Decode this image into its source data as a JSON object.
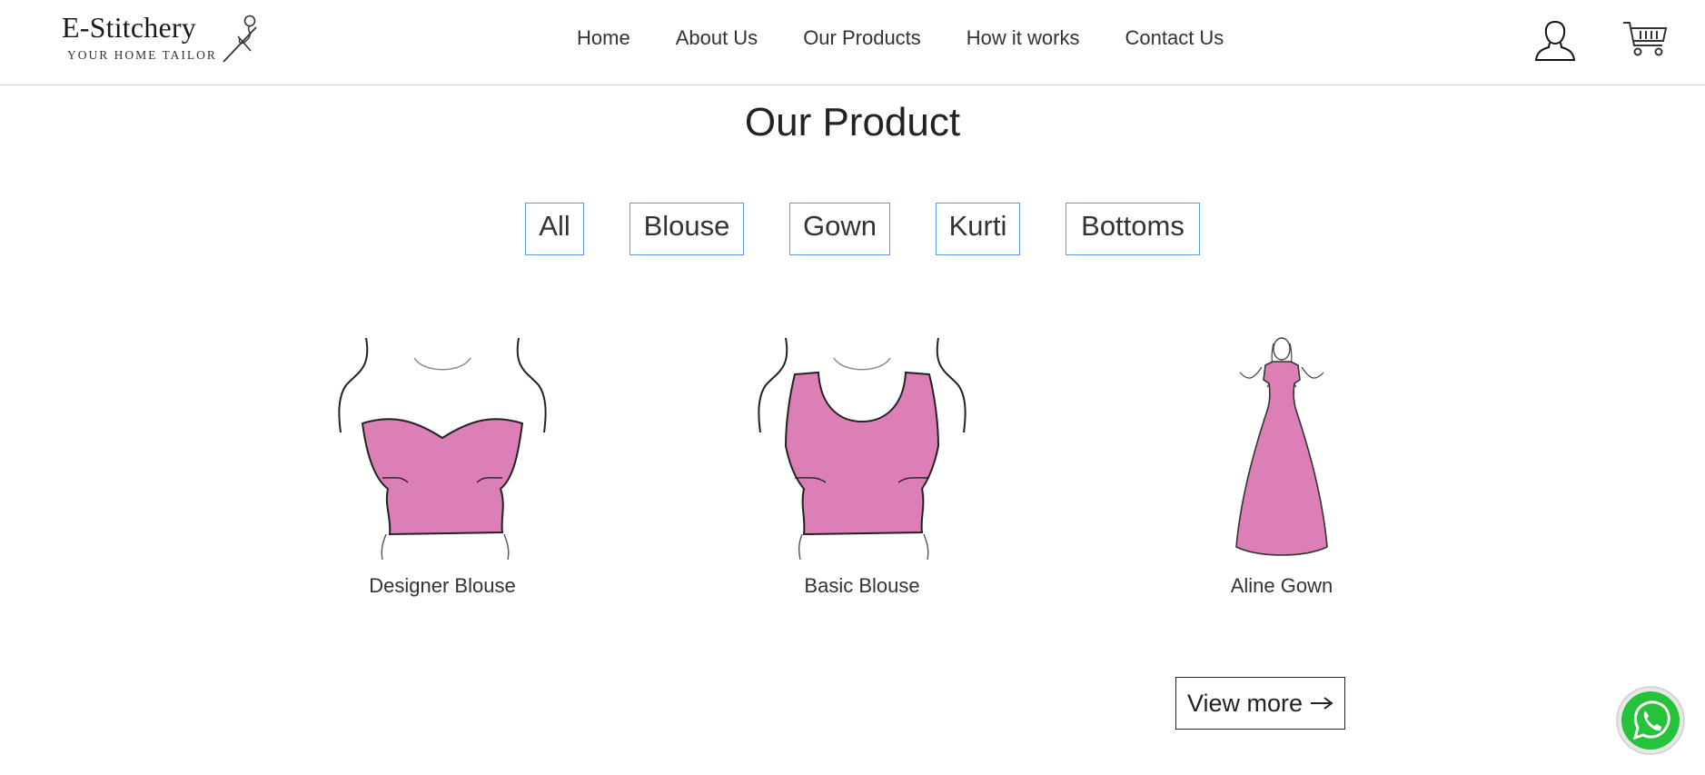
{
  "logo": {
    "title": "E-Stitchery",
    "tagline": "YOUR HOME TAILOR",
    "icon": "needle-thread-icon"
  },
  "nav": {
    "items": [
      {
        "label": "Home"
      },
      {
        "label": "About Us"
      },
      {
        "label": "Our Products"
      },
      {
        "label": "How it works"
      },
      {
        "label": "Contact Us"
      }
    ]
  },
  "header_icons": {
    "user": "user-icon",
    "cart": "shopping-cart-icon"
  },
  "main": {
    "title": "Our Product",
    "filters": [
      {
        "label": "All"
      },
      {
        "label": "Blouse"
      },
      {
        "label": "Gown"
      },
      {
        "label": "Kurti"
      },
      {
        "label": "Bottoms"
      }
    ],
    "products": [
      {
        "name": "Designer Blouse"
      },
      {
        "name": "Basic Blouse"
      },
      {
        "name": "Aline Gown"
      }
    ],
    "view_more": "View more"
  },
  "floating": {
    "whatsapp": "whatsapp-icon"
  },
  "colors": {
    "accent_border": "#5b9ee0",
    "product_pink": "#dc7fb7",
    "whatsapp_green": "#25c23a"
  }
}
